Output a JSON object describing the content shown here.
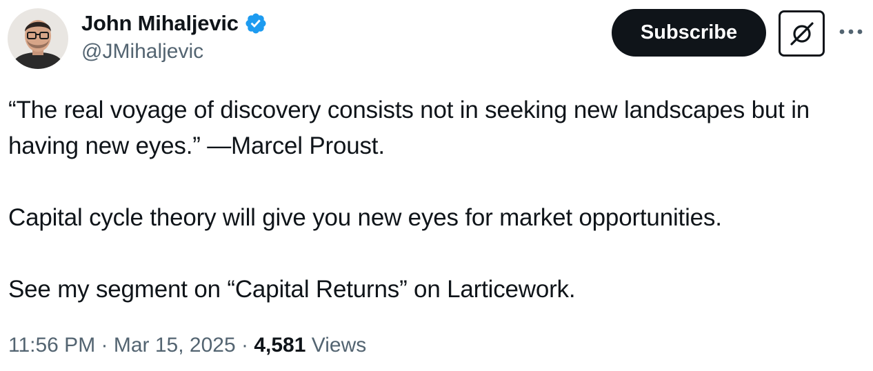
{
  "author": {
    "display_name": "John Mihaljevic",
    "handle": "@JMihaljevic",
    "verified": true,
    "verified_color": "#1d9bf0"
  },
  "actions": {
    "subscribe_label": "Subscribe",
    "grok_icon": "grok-icon",
    "more_icon": "more-dots-icon"
  },
  "tweet": {
    "paragraphs": [
      "“The real voyage of discovery consists not in seeking new landscapes but in having new eyes.” —Marcel Proust.",
      "Capital cycle theory will give you new eyes for market opportunities.",
      "See my segment on “Capital Returns” on Larticework."
    ],
    "time": "11:56 PM",
    "separator": "·",
    "date": "Mar 15, 2025",
    "views_count": "4,581",
    "views_label": "Views"
  },
  "colors": {
    "text": "#0f1419",
    "secondary": "#536471",
    "button_bg": "#0f1419"
  }
}
